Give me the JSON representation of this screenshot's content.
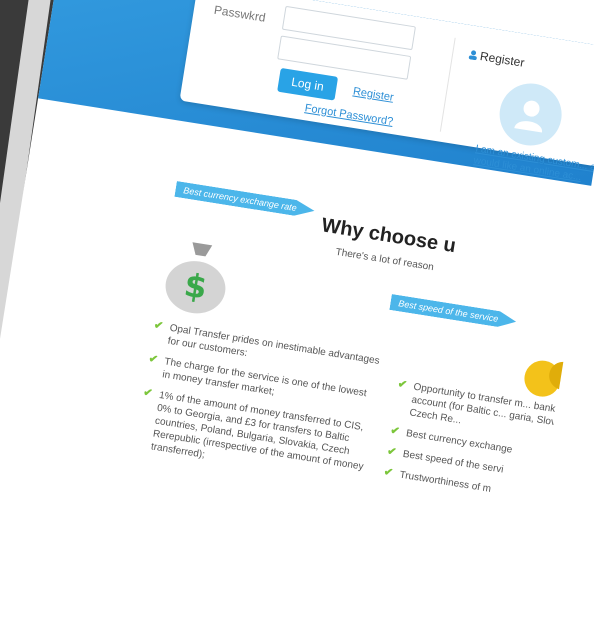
{
  "login": {
    "password_label": "Passwkrd",
    "login_button": "Log in",
    "register_link": "Register",
    "forgot_link": "Forgot Password?"
  },
  "register_panel": {
    "heading": "Register",
    "existing_text": "I am an existing custom... and would like an online ac..."
  },
  "section": {
    "title": "Why choose u",
    "subtitle": "There's a lot of reason"
  },
  "ribbons": {
    "best_rate": "Best currency exchange rate",
    "best_speed": "Best speed of the service"
  },
  "left_list": [
    "Opal Transfer prides on inestimable advantages for our customers:",
    "The charge for the service is one of the lowest in money transfer market;",
    "1% of the amount of money transferred to CIS, 0% to Georgia, and £3 for transfers to Baltic countries, Poland, Bulgaria, Slovakia, Czech Rerepublic (irrespective of the amount of money transferred);"
  ],
  "right_list": [
    "Opportunity to transfer m... bank account (for Baltic c... garia, Slovakia, Czech Re...",
    "Best currency exchange",
    "Best speed of the servi",
    "Trustworthiness of m"
  ],
  "icons": {
    "money_bag": "money-bag-icon",
    "coins": "coins-icon",
    "user": "user-icon",
    "check": "check-icon"
  },
  "colors": {
    "hero_blue": "#1e7fcc",
    "accent": "#29a3e6",
    "check_green": "#7cc63b"
  }
}
